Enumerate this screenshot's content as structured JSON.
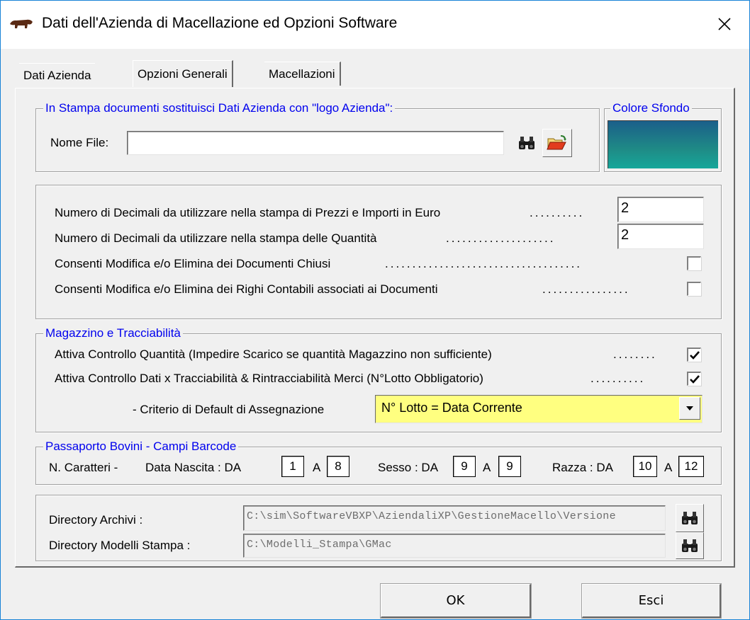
{
  "window": {
    "title": "Dati dell'Azienda di Macellazione ed Opzioni Software"
  },
  "tabs": [
    {
      "label": "Dati Azienda",
      "active": false
    },
    {
      "label": "Opzioni Generali",
      "active": true
    },
    {
      "label": "Macellazioni",
      "active": false
    }
  ],
  "logo_group": {
    "legend": "In Stampa documenti sostituisci Dati Azienda con \"logo Azienda\":",
    "file_label": "Nome File:",
    "file_value": ""
  },
  "color_group": {
    "legend": "Colore Sfondo",
    "color": "#1f8b86"
  },
  "decimals_group": {
    "prices_label": "Numero di Decimali da utilizzare nella stampa di Prezzi e Importi in Euro",
    "prices_value": "2",
    "qty_label": "Numero di Decimali da utilizzare nella stampa delle Quantità",
    "qty_value": "2",
    "closed_docs_label": "Consenti Modifica e/o Elimina dei Documenti Chiusi",
    "closed_docs_checked": false,
    "accounting_label": "Consenti Modifica e/o Elimina dei Righi Contabili associati ai Documenti",
    "accounting_checked": false
  },
  "warehouse_group": {
    "legend": "Magazzino e Tracciabilità",
    "qty_control_label": "Attiva Controllo Quantità  (Impedire Scarico se quantità Magazzino non sufficiente)",
    "qty_control_checked": true,
    "trace_label": "Attiva Controllo Dati x Tracciabilità & Rintracciabilità Merci (N°Lotto Obbligatorio)",
    "trace_checked": true,
    "criteria_label": "- Criterio di Default di Assegnazione",
    "criteria_value": "N° Lotto = Data Corrente"
  },
  "passport_group": {
    "legend": "Passaporto Bovini - Campi Barcode",
    "chars_label": "N. Caratteri -",
    "birth_label": "Data Nascita : DA",
    "birth_from": "1",
    "birth_a": "A",
    "birth_to": "8",
    "sex_label": "Sesso : DA",
    "sex_from": "9",
    "sex_a": "A",
    "sex_to": "9",
    "breed_label": "Razza : DA",
    "breed_from": "10",
    "breed_a": "A",
    "breed_to": "12"
  },
  "dirs_group": {
    "archive_label": "Directory Archivi :",
    "archive_value": "C:\\sim\\SoftwareVBXP\\AziendaliXP\\GestioneMacello\\Versione",
    "templates_label": "Directory Modelli Stampa :",
    "templates_value": "C:\\Modelli_Stampa\\GMac"
  },
  "buttons": {
    "ok": "OK",
    "cancel": "Esci"
  }
}
